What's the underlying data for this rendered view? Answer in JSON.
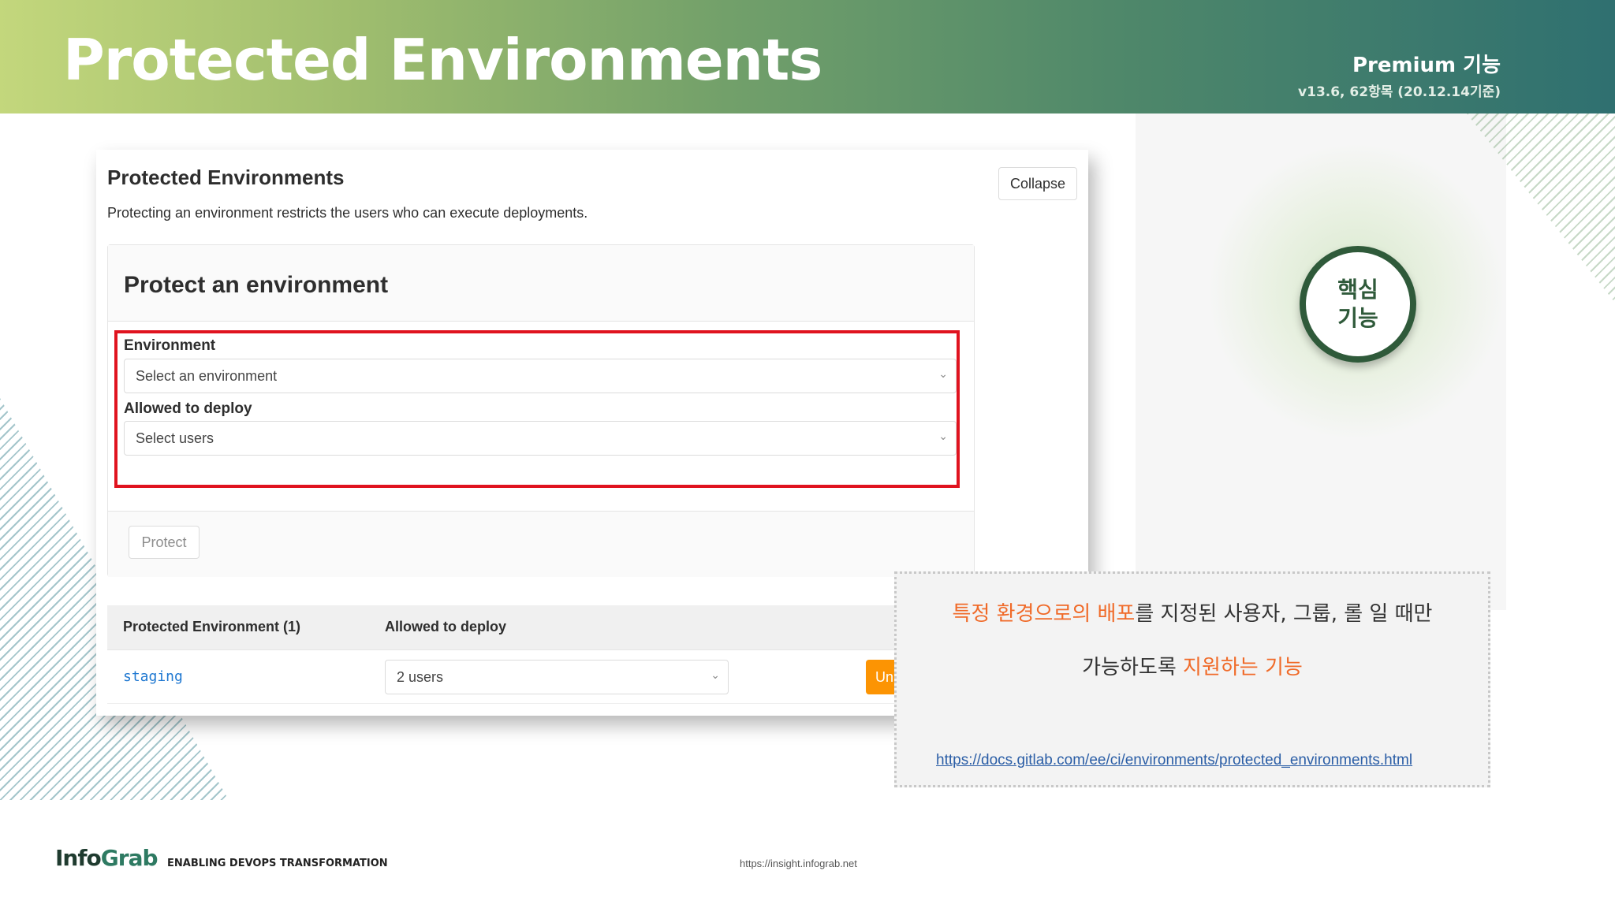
{
  "banner": {
    "title": "Protected Environments",
    "premium": "Premium 기능",
    "version": "v13.6, 62항목 (20.12.14기준)"
  },
  "screenshot": {
    "heading": "Protected Environments",
    "description": "Protecting an environment restricts the users who can execute deployments.",
    "collapse_label": "Collapse",
    "form": {
      "title": "Protect an environment",
      "environment_label": "Environment",
      "environment_placeholder": "Select an environment",
      "allowed_label": "Allowed to deploy",
      "allowed_placeholder": "Select users",
      "protect_label": "Protect"
    },
    "table": {
      "headers": [
        "Protected Environment (1)",
        "Allowed to deploy"
      ],
      "row": {
        "environment": "staging",
        "allowed": "2 users",
        "unprotect_label": "Un"
      }
    }
  },
  "badge": {
    "line1": "핵심",
    "line2": "기능"
  },
  "callout": {
    "line1_highlight": "특정 환경으로의 배포",
    "line1_rest": "를 지정된 사용자, 그룹, 롤 일 때만",
    "line2_pre": "가능하도록 ",
    "line2_highlight": "지원하는 기능",
    "link": "https://docs.gitlab.com/ee/ci/environments/protected_environments.html"
  },
  "footer": {
    "logo_info": "Info",
    "logo_grab": "Grab",
    "tagline": "ENABLING DEVOPS TRANSFORMATION",
    "url": "https://insight.infograb.net"
  },
  "colors": {
    "highlight_border": "#e0131f",
    "accent_orange": "#f06a28",
    "unprotect_button": "#fc9403",
    "badge_green": "#2f5a3a",
    "link_blue": "#1f78d1"
  },
  "icons": [
    "chevron-down-icon"
  ]
}
